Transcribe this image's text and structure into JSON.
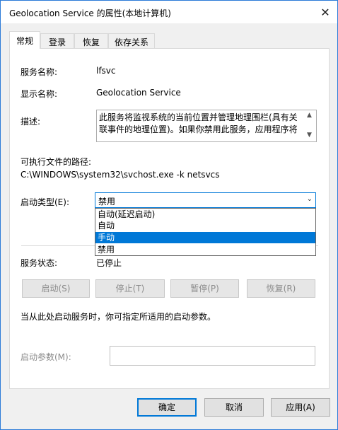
{
  "window": {
    "title": "Geolocation Service 的属性(本地计算机)",
    "close_glyph": "✕"
  },
  "tabs": [
    {
      "label": "常规",
      "active": true
    },
    {
      "label": "登录",
      "active": false
    },
    {
      "label": "恢复",
      "active": false
    },
    {
      "label": "依存关系",
      "active": false
    }
  ],
  "general": {
    "service_name_label": "服务名称:",
    "service_name_value": "lfsvc",
    "display_name_label": "显示名称:",
    "display_name_value": "Geolocation Service",
    "description_label": "描述:",
    "description_line1": "此服务将监视系统的当前位置并管理地理围栏(具有关",
    "description_line2": "联事件的地理位置)。如果你禁用此服务，应用程序将",
    "exe_path_label": "可执行文件的路径:",
    "exe_path_value": "C:\\WINDOWS\\system32\\svchost.exe -k netsvcs",
    "startup_type_label": "启动类型(E):",
    "startup_type_selected": "禁用",
    "startup_options": [
      "自动(延迟启动)",
      "自动",
      "手动",
      "禁用"
    ],
    "highlighted_option_index": 2,
    "service_status_label": "服务状态:",
    "service_status_value": "已停止",
    "hint_text": "当从此处启动服务时，你可指定所适用的启动参数。",
    "start_params_label": "启动参数(M):",
    "start_params_value": ""
  },
  "control_buttons": {
    "start": "启动(S)",
    "stop": "停止(T)",
    "pause": "暂停(P)",
    "resume": "恢复(R)"
  },
  "dialog_buttons": {
    "ok": "确定",
    "cancel": "取消",
    "apply": "应用(A)"
  },
  "icons": {
    "scroll_up": "▲",
    "scroll_down": "▼",
    "dropdown_arrow": "⌄"
  },
  "colors": {
    "accent": "#0078d7",
    "window_border": "#2b7bd8",
    "disabled_text": "#8c8c8c"
  }
}
